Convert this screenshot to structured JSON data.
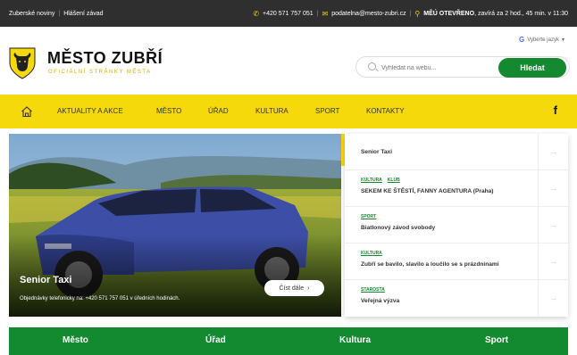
{
  "topbar": {
    "left_links": [
      "Zuberské noviny",
      "Hlášení závad"
    ],
    "phone": "+420 571 757 051",
    "email": "podatelna@mesto-zubri.cz",
    "hours_status": "MĚÚ OTEVŘENO",
    "hours_detail": ", zavírá za 2 hod., 45 min. v 11:30"
  },
  "header": {
    "title": "MĚSTO ZUBŘÍ",
    "subtitle": "OFICIÁLNÍ STRÁNKY MĚSTA",
    "language_label": "Vyberte jazyk",
    "search_placeholder": "Vyhledat na webu...",
    "search_button": "Hledat"
  },
  "nav": {
    "items": [
      "AKTUALITY A AKCE",
      "MĚSTO",
      "ÚŘAD",
      "KULTURA",
      "SPORT",
      "KONTAKTY"
    ],
    "facebook_glyph": "f"
  },
  "hero": {
    "title": "Senior Taxi",
    "text": "Objednávky telefonicky na: +420 571 757 051 v úředních hodinách.",
    "button": "Číst dále"
  },
  "news": [
    {
      "tags": [],
      "title": "Senior Taxi"
    },
    {
      "tags": [
        "KULTURA",
        "KLUB"
      ],
      "title": "SEKEM KE ŠTĚSTÍ, FANNY AGENTURA (Praha)"
    },
    {
      "tags": [
        "SPORT"
      ],
      "title": "Biatlonový závod svobody"
    },
    {
      "tags": [
        "KULTURA"
      ],
      "title": "Zubří se bavilo, slavilo a loučilo se s prázdninami"
    },
    {
      "tags": [
        "STAROSTA"
      ],
      "title": "Veřejná výzva"
    }
  ],
  "tabs": [
    "Město",
    "Úřad",
    "Kultura",
    "Sport"
  ],
  "colors": {
    "accent_yellow": "#f5d90a",
    "brand_green": "#138a2f",
    "topbar_dark": "#2f2f2f"
  }
}
